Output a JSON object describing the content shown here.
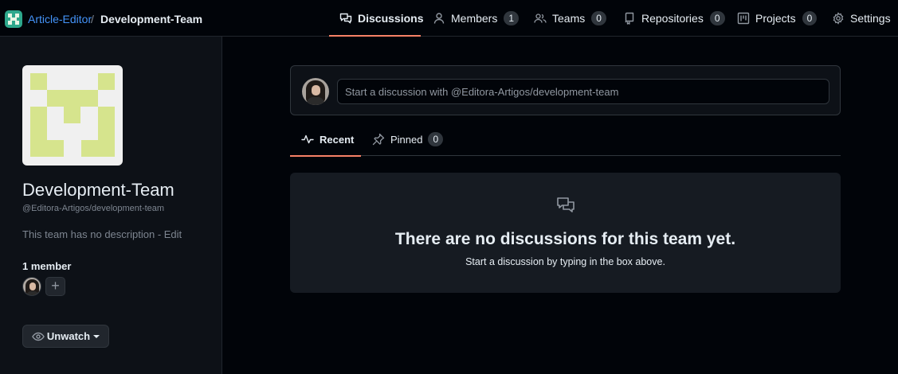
{
  "header": {
    "org_name": "Article-Editor",
    "separator": "/",
    "team_name": "Development-Team",
    "tabs": [
      {
        "label": "Discussions",
        "icon": "comment-discussion-icon",
        "active": true
      },
      {
        "label": "Members",
        "icon": "person-icon",
        "count": "1"
      },
      {
        "label": "Teams",
        "icon": "people-icon",
        "count": "0"
      },
      {
        "label": "Repositories",
        "icon": "repo-icon",
        "count": "0"
      },
      {
        "label": "Projects",
        "icon": "project-icon",
        "count": "0"
      },
      {
        "label": "Settings",
        "icon": "gear-icon"
      }
    ]
  },
  "sidebar": {
    "team_name": "Development-Team",
    "team_slug": "@Editora-Artigos/development-team",
    "description": "This team has no description",
    "description_sep": " - ",
    "edit_label": "Edit",
    "member_count": "1 member",
    "add_member": "+",
    "unwatch_label": "Unwatch"
  },
  "main": {
    "composer_placeholder": "Start a discussion with @Editora-Artigos/development-team",
    "tabs": [
      {
        "label": "Recent",
        "icon": "pulse-icon",
        "active": true
      },
      {
        "label": "Pinned",
        "icon": "pin-icon",
        "count": "0"
      }
    ],
    "blankslate": {
      "icon": "comment-discussion-icon",
      "title": "There are no discussions for this team yet.",
      "subtitle": "Start a discussion by typing in the box above."
    }
  },
  "colors": {
    "accent_underline": "#f78166",
    "link": "#4493f8",
    "identicon": "#d6e48d",
    "org_logo": "#2ea88c"
  }
}
